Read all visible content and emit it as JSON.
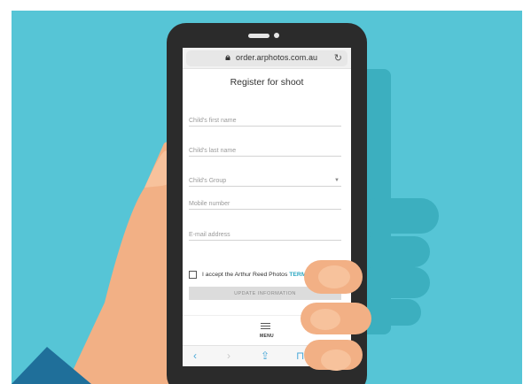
{
  "browser": {
    "url": "order.arphotos.com.au",
    "reload_icon": "reload-icon",
    "lock_icon": "lock-icon"
  },
  "form": {
    "title": "Register for shoot",
    "fields": {
      "first_name": "Child's first name",
      "last_name": "Child's last name",
      "group": "Child's Group",
      "mobile": "Mobile number",
      "email": "E-mail address"
    },
    "accept_text": "I accept the Arthur Reed Photos",
    "terms_link": "TERMS OF USE",
    "submit_label": "UPDATE INFORMATION"
  },
  "menu": {
    "label": "MENU",
    "icon": "hamburger-icon"
  },
  "toolbar": {
    "back_glyph": "‹",
    "forward_glyph": "›",
    "share_glyph": "⇪",
    "bookmarks_glyph": "⊓"
  },
  "colors": {
    "background": "#56c5d6",
    "background_shape": "#3cafbf",
    "phone_body": "#2b2b2b",
    "skin": "#f2b085",
    "sleeve": "#1f6f9a",
    "link": "#2aa7c2",
    "nav_icon": "#4aa8d8"
  }
}
